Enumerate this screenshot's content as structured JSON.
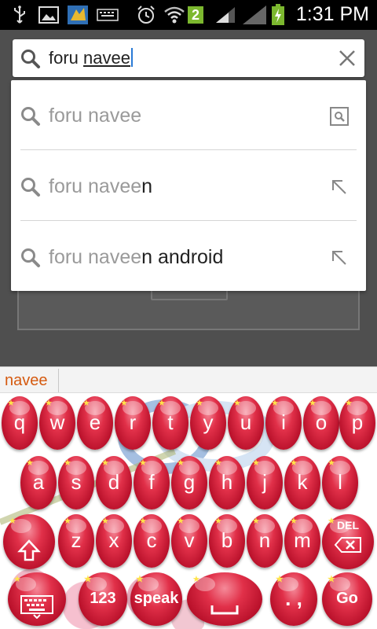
{
  "status_bar": {
    "time": "1:31 PM",
    "sim_badge": "2",
    "icons": [
      "usb-icon",
      "image-icon",
      "app-icon",
      "keyboard-icon",
      "alarm-icon",
      "wifi-icon",
      "signal-icon",
      "signal2-icon",
      "battery-icon"
    ]
  },
  "search": {
    "typed": "foru ",
    "composing": "navee",
    "search_icon": "search-icon",
    "clear_icon": "close-icon"
  },
  "suggestions": [
    {
      "typed": "foru navee",
      "rest": "",
      "action_icon": "search-in-page-icon"
    },
    {
      "typed": "foru navee",
      "rest": "n",
      "action_icon": "arrow-up-left-icon"
    },
    {
      "typed": "foru navee",
      "rest": "n android",
      "action_icon": "arrow-up-left-icon"
    }
  ],
  "candidate": {
    "word": "navee"
  },
  "keyboard": {
    "row1": [
      "q",
      "w",
      "e",
      "r",
      "t",
      "y",
      "u",
      "i",
      "o",
      "p"
    ],
    "row2": [
      "a",
      "s",
      "d",
      "f",
      "g",
      "h",
      "j",
      "k",
      "l"
    ],
    "row3": [
      "z",
      "x",
      "c",
      "v",
      "b",
      "n",
      "m"
    ],
    "shift_icon": "shift-icon",
    "del_label": "DEL",
    "keyboard_icon": "keyboard-icon",
    "num_label": "123",
    "speak_label": "speak",
    "space_icon": "space-icon",
    "punct_label": ". ,",
    "go_label": "Go"
  },
  "colors": {
    "key_red": "#e13049",
    "candidate_orange": "#d55a10",
    "cursor_blue": "#2a7ad6"
  }
}
